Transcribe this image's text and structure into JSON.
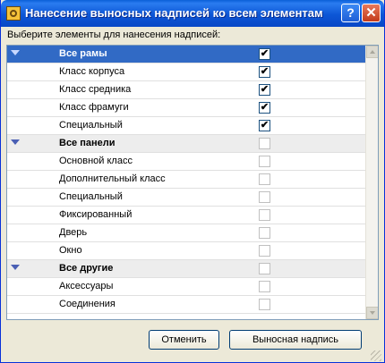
{
  "window": {
    "title": "Нанесение выносных надписей ко всем элементам",
    "help_label": "?",
    "close_label": "✕"
  },
  "prompt": "Выберите элементы для нанесения надписей:",
  "rows": [
    {
      "label": "Все рамы",
      "group": true,
      "checked": true,
      "enabled": true,
      "selected": true
    },
    {
      "label": "Класс корпуса",
      "group": false,
      "checked": true,
      "enabled": true
    },
    {
      "label": "Класс средника",
      "group": false,
      "checked": true,
      "enabled": true
    },
    {
      "label": "Класс фрамуги",
      "group": false,
      "checked": true,
      "enabled": true
    },
    {
      "label": "Специальный",
      "group": false,
      "checked": true,
      "enabled": true
    },
    {
      "label": "Все панели",
      "group": true,
      "checked": false,
      "enabled": false
    },
    {
      "label": "Основной класс",
      "group": false,
      "checked": false,
      "enabled": false
    },
    {
      "label": "Дополнительный класс",
      "group": false,
      "checked": false,
      "enabled": false
    },
    {
      "label": "Специальный",
      "group": false,
      "checked": false,
      "enabled": false
    },
    {
      "label": "Фиксированный",
      "group": false,
      "checked": false,
      "enabled": false
    },
    {
      "label": "Дверь",
      "group": false,
      "checked": false,
      "enabled": false
    },
    {
      "label": "Окно",
      "group": false,
      "checked": false,
      "enabled": false
    },
    {
      "label": "Все другие",
      "group": true,
      "checked": false,
      "enabled": false
    },
    {
      "label": "Аксессуары",
      "group": false,
      "checked": false,
      "enabled": false
    },
    {
      "label": "Соединения",
      "group": false,
      "checked": false,
      "enabled": false
    }
  ],
  "buttons": {
    "cancel": "Отменить",
    "callout": "Выносная надпись"
  },
  "colors": {
    "titlebar": "#0a5fd8",
    "selection": "#316ac5",
    "group_row": "#ededed",
    "dialog_bg": "#ece9d8"
  }
}
